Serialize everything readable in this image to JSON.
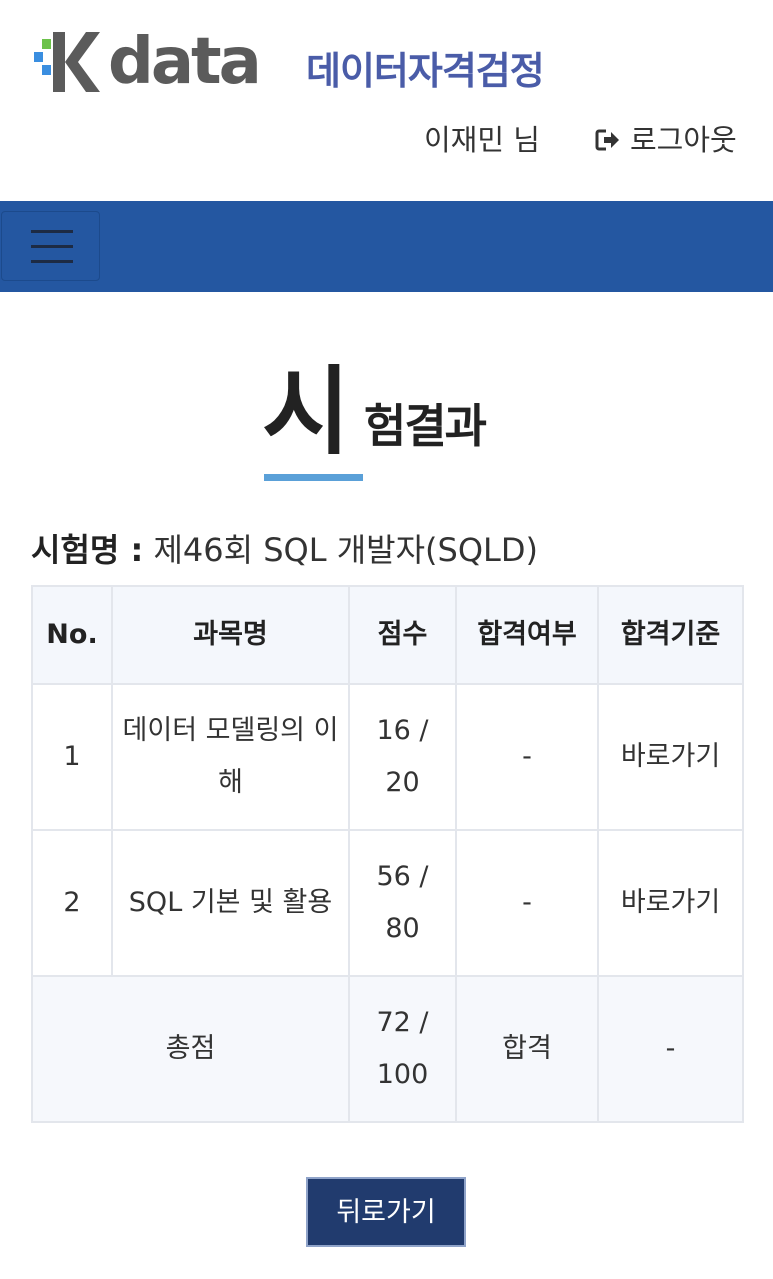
{
  "header": {
    "logo_word": "data",
    "logo_subtitle": "데이터자격검정",
    "user_name": "이재민 님",
    "logout_label": "로그아웃"
  },
  "page": {
    "title_first": "시",
    "title_rest": "험결과"
  },
  "exam": {
    "label": "시험명 :",
    "value": " 제46회 SQL 개발자(SQLD)"
  },
  "table": {
    "columns": [
      "No.",
      "과목명",
      "점수",
      "합격여부",
      "합격기준"
    ],
    "rows": [
      {
        "no": "1",
        "subject": "데이터 모델링의 이해",
        "score": "16 / 20",
        "pass": "-",
        "criteria": "바로가기"
      },
      {
        "no": "2",
        "subject": "SQL 기본 및 활용",
        "score": "56 / 80",
        "pass": "-",
        "criteria": "바로가기"
      }
    ],
    "total": {
      "label": "총점",
      "score": "72 / 100",
      "pass": "합격",
      "criteria": "-"
    }
  },
  "actions": {
    "back_label": "뒤로가기"
  },
  "colors": {
    "navbar": "#2457a1",
    "logo_subtitle": "#4a5ca8",
    "accent_underline": "#5aa0d8",
    "button": "#213b6e"
  }
}
